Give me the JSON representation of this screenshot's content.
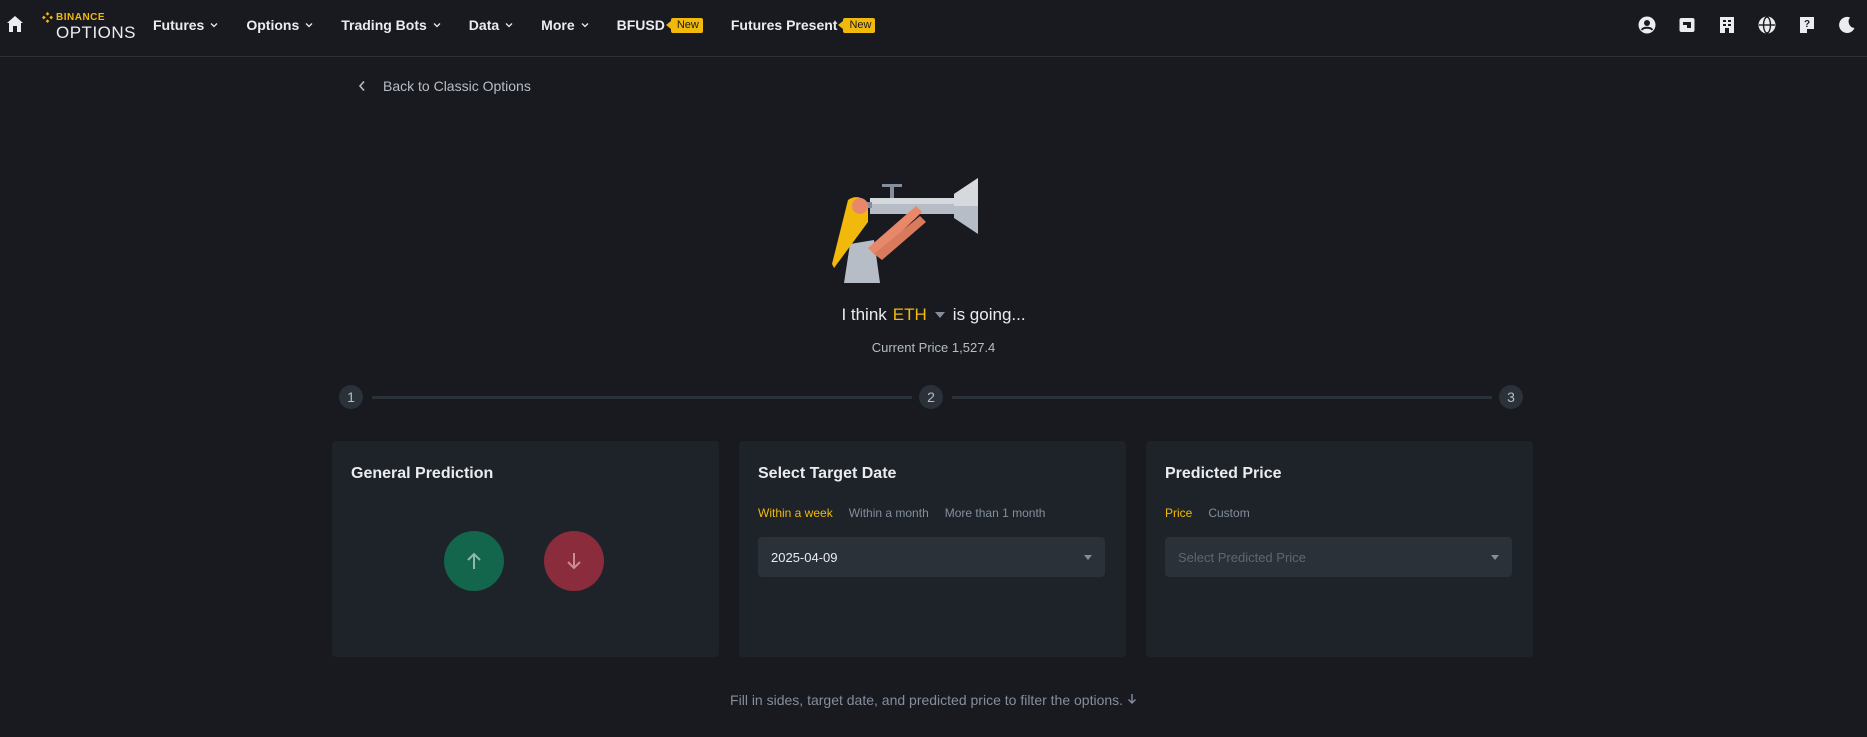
{
  "nav": {
    "logo_top": "BINANCE",
    "logo_bottom": "OPTIONS",
    "items": [
      {
        "label": "Futures"
      },
      {
        "label": "Options"
      },
      {
        "label": "Trading Bots"
      },
      {
        "label": "Data"
      },
      {
        "label": "More"
      },
      {
        "label": "BFUSD",
        "badge": "New"
      },
      {
        "label": "Futures Present",
        "badge": "New"
      }
    ],
    "right_icons": [
      "user-icon",
      "wallet-icon",
      "orders-icon",
      "globe-icon",
      "help-icon",
      "theme-toggle-icon"
    ]
  },
  "back_link": "Back to Classic Options",
  "hero": {
    "prefix": "I think",
    "coin": "ETH",
    "suffix": "is going...",
    "current_price_label": "Current Price",
    "current_price_value": "1,527.4"
  },
  "steps": [
    "1",
    "2",
    "3"
  ],
  "cards": {
    "prediction": {
      "title": "General Prediction",
      "up": "up-arrow-icon",
      "down": "down-arrow-icon"
    },
    "target_date": {
      "title": "Select Target Date",
      "tabs": [
        "Within a week",
        "Within a month",
        "More than 1 month"
      ],
      "active_tab": "Within a week",
      "value": "2025-04-09"
    },
    "predicted_price": {
      "title": "Predicted Price",
      "tabs": [
        "Price",
        "Custom"
      ],
      "active_tab": "Price",
      "placeholder": "Select Predicted Price"
    }
  },
  "footer_hint": "Fill in sides, target date, and predicted price to filter the options.",
  "colors": {
    "background": "#181a20",
    "card": "#1e2329",
    "accent": "#f0b90b",
    "up": "#13654b",
    "down": "#8a2c3c"
  }
}
